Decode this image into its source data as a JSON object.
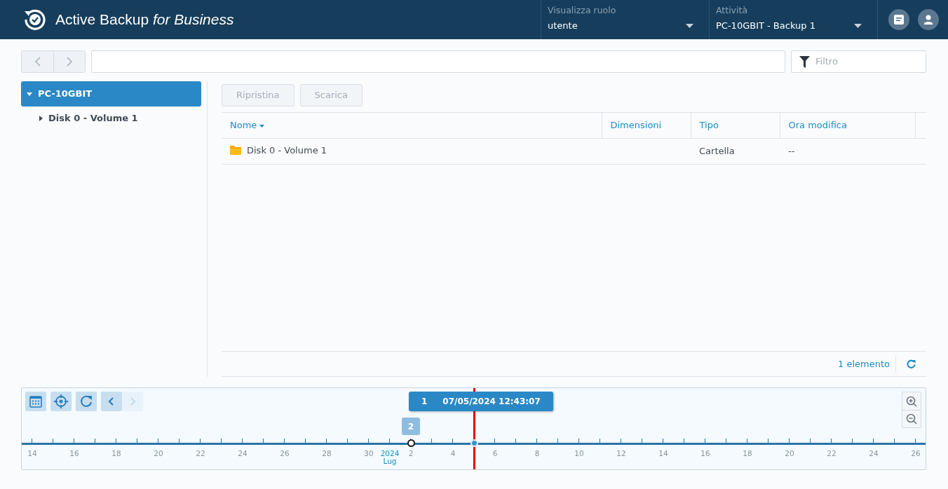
{
  "header": {
    "title": "Active Backup *for Business*",
    "dropdowns": [
      {
        "label": "Visualizza ruolo",
        "value": "utente"
      },
      {
        "label": "Attività",
        "value": "PC-10GBIT - Backup 1"
      }
    ]
  },
  "toolbar": {
    "back_disabled": true,
    "forward_disabled": true,
    "filter": {
      "placeholder": "Filtro"
    }
  },
  "tree": [
    {
      "label": "PC-10GBIT",
      "selected": true,
      "expanded": true,
      "children": [
        {
          "label": "Disk 0 - Volume 1",
          "selected": false,
          "expanded": false
        }
      ]
    }
  ],
  "actions": [
    {
      "label": "Ripristina",
      "disabled": true
    },
    {
      "label": "Scarica",
      "disabled": true
    }
  ],
  "table": {
    "columns": [
      {
        "label": "Nome",
        "sorted": true
      },
      {
        "label": "Dimensioni",
        "sorted": false
      },
      {
        "label": "Tipo",
        "sorted": false
      },
      {
        "label": "Ora modifica",
        "sorted": false
      }
    ],
    "rows": [
      {
        "name": "Disk 0 - Volume 1",
        "type": "Cartella",
        "modified": "--",
        "kind": "folder"
      }
    ]
  },
  "footer": {
    "count": "1 elemento"
  },
  "timeline": {
    "prev_disabled": false,
    "next_disabled": true,
    "days": [
      {
        "kind": "label",
        "label": "14"
      },
      {
        "kind": "tick"
      },
      {
        "kind": "label",
        "label": "16"
      },
      {
        "kind": "tick"
      },
      {
        "kind": "label",
        "label": "18"
      },
      {
        "kind": "tick"
      },
      {
        "kind": "label",
        "label": "20"
      },
      {
        "kind": "tick"
      },
      {
        "kind": "label",
        "label": "22"
      },
      {
        "kind": "tick"
      },
      {
        "kind": "label",
        "label": "24"
      },
      {
        "kind": "tick"
      },
      {
        "kind": "label",
        "label": "26"
      },
      {
        "kind": "tick"
      },
      {
        "kind": "label",
        "label": "28"
      },
      {
        "kind": "tick"
      },
      {
        "kind": "label",
        "label": "30"
      },
      {
        "kind": "month",
        "label": "2024",
        "sub": "Lug"
      },
      {
        "kind": "label",
        "label": "2",
        "snapshot": {
          "count": "2",
          "selected": false
        }
      },
      {
        "kind": "tick"
      },
      {
        "kind": "label",
        "label": "4"
      },
      {
        "kind": "tick",
        "current": true,
        "snapshot": {
          "count": "1",
          "selected": true,
          "time": "07/05/2024 12:43:07"
        }
      },
      {
        "kind": "label",
        "label": "6"
      },
      {
        "kind": "tick"
      },
      {
        "kind": "label",
        "label": "8"
      },
      {
        "kind": "tick"
      },
      {
        "kind": "label",
        "label": "10"
      },
      {
        "kind": "tick"
      },
      {
        "kind": "label",
        "label": "12"
      },
      {
        "kind": "tick"
      },
      {
        "kind": "label",
        "label": "14"
      },
      {
        "kind": "tick"
      },
      {
        "kind": "label",
        "label": "16"
      },
      {
        "kind": "tick"
      },
      {
        "kind": "label",
        "label": "18"
      },
      {
        "kind": "tick"
      },
      {
        "kind": "label",
        "label": "20"
      },
      {
        "kind": "tick"
      },
      {
        "kind": "label",
        "label": "22"
      },
      {
        "kind": "tick"
      },
      {
        "kind": "label",
        "label": "24"
      },
      {
        "kind": "tick"
      },
      {
        "kind": "label",
        "label": "26"
      }
    ]
  }
}
